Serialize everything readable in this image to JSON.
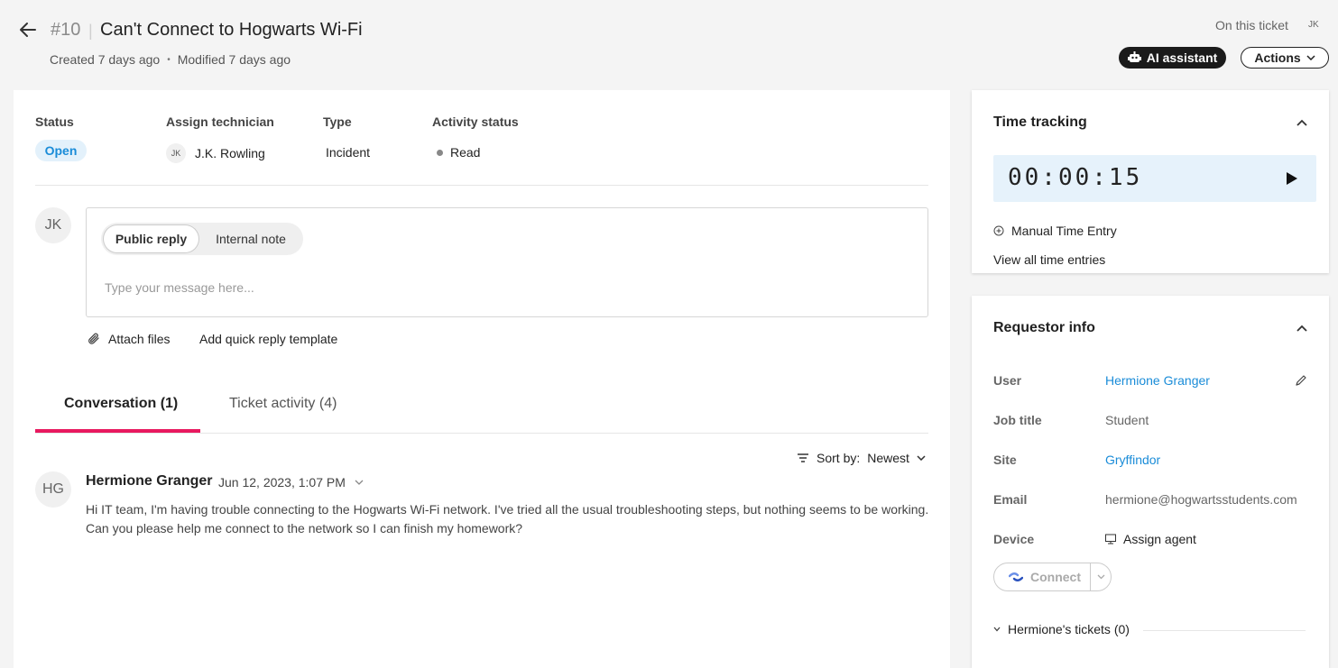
{
  "header": {
    "ticket_number": "#10",
    "separator": "|",
    "title": "Can't Connect to Hogwarts Wi-Fi",
    "created": "Created 7 days ago",
    "modified": "Modified 7 days ago",
    "on_this_ticket": "On this ticket",
    "viewer_initials": "JK",
    "ai_assistant_label": "AI assistant",
    "actions_label": "Actions"
  },
  "fields": {
    "status_label": "Status",
    "status_value": "Open",
    "technician_label": "Assign technician",
    "technician_initials": "JK",
    "technician_name": "J.K. Rowling",
    "type_label": "Type",
    "type_value": "Incident",
    "activity_label": "Activity status",
    "activity_value": "Read"
  },
  "reply": {
    "avatar_initials": "JK",
    "tab_public": "Public reply",
    "tab_internal": "Internal note",
    "placeholder": "Type your message here...",
    "attach_label": "Attach files",
    "quick_reply_label": "Add quick reply template"
  },
  "tabs": {
    "conversation": "Conversation (1)",
    "activity": "Ticket activity (4)"
  },
  "sort": {
    "label": "Sort by:",
    "value": "Newest"
  },
  "message": {
    "avatar_initials": "HG",
    "author": "Hermione Granger",
    "date": "Jun 12, 2023, 1:07 PM",
    "body": "Hi IT team, I'm having trouble connecting to the Hogwarts Wi-Fi network. I've tried all the usual troubleshooting steps, but nothing seems to be working. Can you please help me connect to the network so I can finish my homework?"
  },
  "time_tracking": {
    "title": "Time tracking",
    "timer": "00:00:15",
    "manual_entry": "Manual Time Entry",
    "view_all": "View all time entries"
  },
  "requestor": {
    "title": "Requestor info",
    "user_label": "User",
    "user_value": "Hermione Granger",
    "job_label": "Job title",
    "job_value": "Student",
    "site_label": "Site",
    "site_value": "Gryffindor",
    "email_label": "Email",
    "email_value": "hermione@hogwartsstudents.com",
    "device_label": "Device",
    "device_value": "Assign agent",
    "connect_label": "Connect",
    "tickets_label": "Hermione's tickets (0)"
  },
  "colors": {
    "accent_pink": "#e8195f",
    "link_blue": "#1a8cd8",
    "status_bg": "#e3f1fb",
    "timer_bg": "#e6f2fb"
  }
}
